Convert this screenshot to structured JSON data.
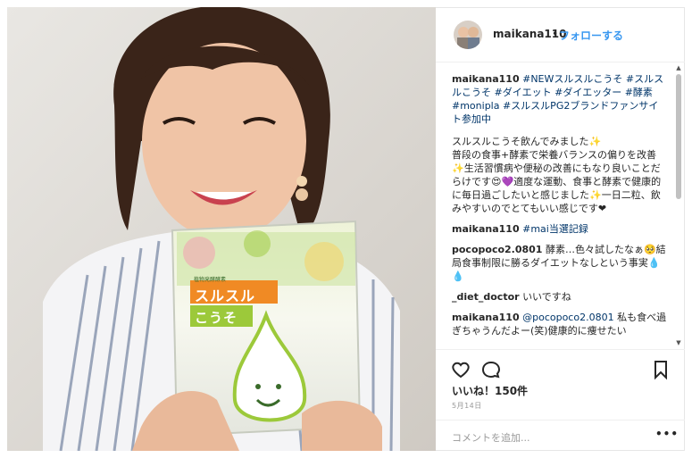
{
  "header": {
    "username": "maikana110",
    "separator": "•",
    "follow_label": "フォローする"
  },
  "caption": {
    "user": "maikana110",
    "text_tags": "#NEWスルスルこうそ #スルスルこうそ #ダイエット #ダイエッター #酵素 #monipla #スルスルPG2ブランドファンサイト参加中",
    "body": "スルスルこうそ飲んでみました✨\n普段の食事+酵素で栄養バランスの偏りを改善✨生活習慣病や便秘の改善にもなり良いことだらけです😍💜適度な運動、食事と酵素で健康的に毎日過ごしたいと感じました✨一日二粒、飲みやすいのでとてもいい感じです❤"
  },
  "comments": [
    {
      "user": "maikana110",
      "text": "#mai当選記録"
    },
    {
      "user": "pocopoco2.0801",
      "text": "酵素…色々試したなぁ🥺結局食事制限に勝るダイエットなしという事実💧💧"
    },
    {
      "user": "_diet_doctor",
      "text": "いいですね"
    },
    {
      "user": "maikana110",
      "mention": "@pocopoco2.0801",
      "text": "私も食べ過ぎちゃうんだよー(笑)健康的に痩せたい"
    }
  ],
  "actions": {
    "like_icon": "heart-outline-icon",
    "comment_icon": "speech-bubble-icon",
    "save_icon": "bookmark-outline-icon"
  },
  "likes_text": "いいね！150件",
  "date_text": "5月14日",
  "add_comment": {
    "placeholder": "コメントを追加...",
    "more_label": "•••"
  },
  "photo": {
    "package_line1": "スルスル",
    "package_line2": "こうそ",
    "package_small": "植物発酵酵素"
  },
  "colors": {
    "link": "#003569",
    "follow": "#3897f0",
    "package_orange": "#f08a24",
    "package_green": "#9cc93a"
  }
}
